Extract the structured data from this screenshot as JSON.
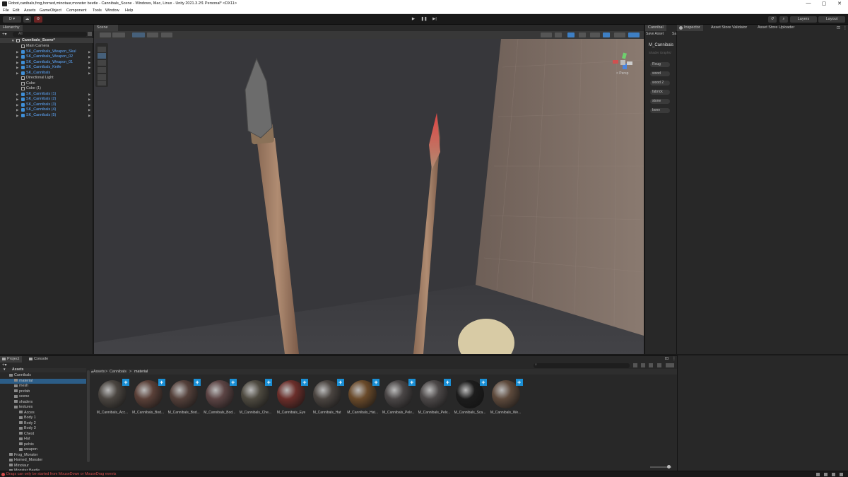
{
  "window": {
    "title": "Robot,canibals,frog,horned,minotaur,monster beetle - Cannibals_Scene - Windows, Mac, Linux - Unity 2021.3.2f1 Personal* <DX11>",
    "minimize": "—",
    "maximize": "▢",
    "close": "✕"
  },
  "menu": [
    "File",
    "Edit",
    "Assets",
    "GameObject",
    "Component",
    "Tools",
    "Window",
    "Help"
  ],
  "toolbar": {
    "account": "D ▾",
    "play": "▶",
    "pause": "❚❚",
    "step": "▶|",
    "layers": "Layers",
    "layout": "Layout"
  },
  "hierarchy": {
    "tab": "Hierarchy",
    "search_placeholder": "All",
    "scene": "Cannibals_Scene*",
    "items": [
      {
        "label": "Main Camera",
        "type": "plain",
        "expandable": false
      },
      {
        "label": "SK_Cannibals_Weapon_Skul",
        "type": "prefab",
        "expandable": true
      },
      {
        "label": "SK_Cannibals_Weapon_02",
        "type": "prefab",
        "expandable": true
      },
      {
        "label": "SK_Cannibals_Weapon_01",
        "type": "prefab",
        "expandable": true
      },
      {
        "label": "SK_Cannibals_Knife",
        "type": "prefab",
        "expandable": true
      },
      {
        "label": "SK_Cannibals",
        "type": "prefab",
        "expandable": true
      },
      {
        "label": "Directional Light",
        "type": "plain",
        "expandable": false
      },
      {
        "label": "Cube",
        "type": "plain",
        "expandable": false
      },
      {
        "label": "Cube (1)",
        "type": "plain",
        "expandable": false
      },
      {
        "label": "SK_Cannibals (1)",
        "type": "prefab",
        "expandable": true
      },
      {
        "label": "SK_Cannibals (2)",
        "type": "prefab",
        "expandable": true
      },
      {
        "label": "SK_Cannibals (3)",
        "type": "prefab",
        "expandable": true
      },
      {
        "label": "SK_Cannibals (4)",
        "type": "prefab",
        "expandable": true
      },
      {
        "label": "SK_Cannibals (5)",
        "type": "prefab",
        "expandable": true
      }
    ]
  },
  "scene": {
    "tab": "Scene",
    "persp": "< Persp"
  },
  "material_panel": {
    "tab": "Cannibal",
    "save_asset": "Save Asset",
    "save_short": "Sa",
    "material_name": "M_Cannibals",
    "shader": "Shader Graphs/",
    "tags": [
      "Roug",
      "wood",
      "wood 2",
      "fabrick",
      "stone",
      "bone"
    ]
  },
  "inspector": {
    "tabs": [
      "Inspector",
      "Asset Store Validator",
      "Asset Store Uploader"
    ]
  },
  "project": {
    "tabs": [
      "Project",
      "Console"
    ],
    "favorites_label": "Assets",
    "tree": [
      {
        "label": "Cannibals",
        "indent": 1,
        "expanded": true
      },
      {
        "label": "material",
        "indent": 2,
        "selected": true
      },
      {
        "label": "mesh",
        "indent": 2
      },
      {
        "label": "prefab",
        "indent": 2
      },
      {
        "label": "scene",
        "indent": 2
      },
      {
        "label": "shaders",
        "indent": 2
      },
      {
        "label": "textures",
        "indent": 2,
        "expanded": true
      },
      {
        "label": "Acces",
        "indent": 3
      },
      {
        "label": "Body 1",
        "indent": 3
      },
      {
        "label": "Body 2",
        "indent": 3
      },
      {
        "label": "Body 3",
        "indent": 3
      },
      {
        "label": "Chest",
        "indent": 3
      },
      {
        "label": "Hat",
        "indent": 3
      },
      {
        "label": "pelvis",
        "indent": 3
      },
      {
        "label": "weapon",
        "indent": 3
      },
      {
        "label": "Frog_Monster",
        "indent": 1
      },
      {
        "label": "Horned_Monster",
        "indent": 1
      },
      {
        "label": "Minotaur",
        "indent": 1
      },
      {
        "label": "Monster Beetle",
        "indent": 1
      }
    ],
    "breadcrumb": [
      "Assets",
      "Cannibals",
      "material"
    ],
    "assets": [
      {
        "name": "M_Cannibals_Acc...",
        "color": "#4a4540"
      },
      {
        "name": "M_Cannibals_Bod...",
        "color": "#5a4038"
      },
      {
        "name": "M_Cannibals_Bod...",
        "color": "#54403a"
      },
      {
        "name": "M_Cannibals_Bod...",
        "color": "#5c4444"
      },
      {
        "name": "M_Cannibals_Che...",
        "color": "#4e4a40"
      },
      {
        "name": "M_Cannibals_Eye",
        "color": "#6b2e2a"
      },
      {
        "name": "M_Cannibals_Hat",
        "color": "#4a4440"
      },
      {
        "name": "M_Cannibals_Hat...",
        "color": "#6a4a2a"
      },
      {
        "name": "M_Cannibals_Pelv...",
        "color": "#4a4646"
      },
      {
        "name": "M_Cannibals_Pelv...",
        "color": "#4c4848"
      },
      {
        "name": "M_Cannibals_Sca...",
        "color": "#1c1c1c"
      },
      {
        "name": "M_Cannibals_We...",
        "color": "#5e4a3c"
      }
    ]
  },
  "status": {
    "error": "Drags can only be started from MouseDown or MouseDrag events"
  },
  "colors": {
    "accent": "#1a8fd5",
    "prefab_text": "#5ea9ff",
    "error": "#d24a4a"
  }
}
